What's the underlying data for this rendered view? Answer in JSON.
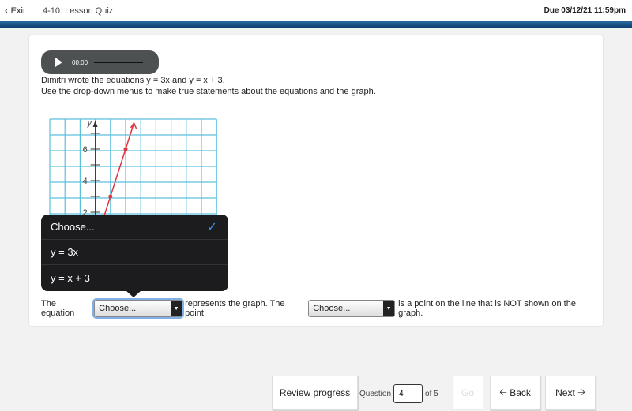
{
  "header": {
    "exit_label": "Exit",
    "quiz_title": "4-10: Lesson Quiz",
    "due": "Due 03/12/21 11:59pm"
  },
  "audio": {
    "time": "00:00"
  },
  "question": {
    "line1": "Dimitri wrote the equations y = 3x and y = x + 3.",
    "line2": "Use the drop-down menus to make true statements about the equations and the graph."
  },
  "graph": {
    "y_axis_label": "y",
    "y_ticks": [
      "2",
      "4",
      "6"
    ],
    "line_color": "#e0333c",
    "grid_color": "#5bc0de",
    "points": [
      [
        1,
        3
      ],
      [
        2,
        6
      ]
    ]
  },
  "dropdown_menu": {
    "options": [
      "Choose...",
      "y = 3x",
      "y = x + 3"
    ],
    "selected": "Choose..."
  },
  "sentence": {
    "part1": "The equation",
    "select1": "Choose...",
    "part2": "represents the graph. The point",
    "select2": "Choose...",
    "part3": "is a point on the line that is NOT shown on the graph."
  },
  "footer": {
    "review": "Review progress",
    "question_label": "Question",
    "question_value": "4",
    "of": "of 5",
    "go": "Go",
    "back": "Back",
    "next": "Next"
  }
}
